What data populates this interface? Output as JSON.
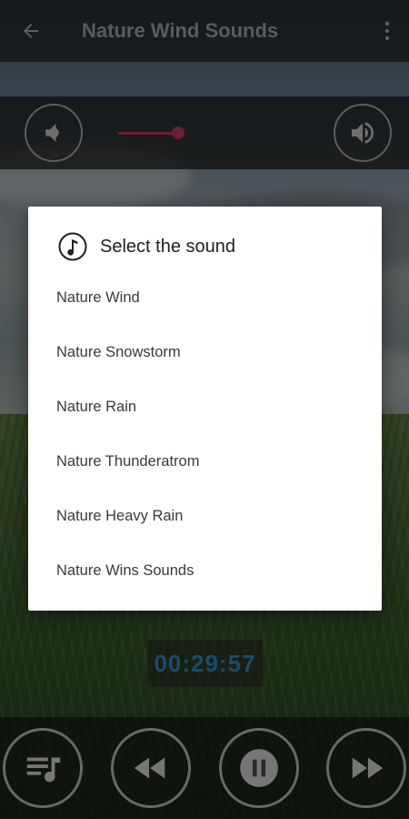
{
  "app_bar": {
    "title": "Nature Wind Sounds",
    "back_icon": "arrow-left-icon",
    "menu_icon": "more-vertical-icon"
  },
  "volume": {
    "level": 0.2,
    "down_icon": "volume-down-icon",
    "up_icon": "volume-up-icon"
  },
  "dialog": {
    "title": "Select the sound",
    "title_icon": "music-note-icon",
    "items": [
      {
        "label": "Nature Wind"
      },
      {
        "label": "Nature Snowstorm"
      },
      {
        "label": "Nature Rain"
      },
      {
        "label": "Nature Thunderatrom"
      },
      {
        "label": "Nature Heavy Rain"
      },
      {
        "label": "Nature Wins Sounds"
      }
    ]
  },
  "timer": {
    "value": "00:29:57"
  },
  "controls": {
    "playlist_icon": "playlist-music-icon",
    "rewind_icon": "rewind-icon",
    "pause_icon": "pause-icon",
    "forward_icon": "fast-forward-icon"
  },
  "colors": {
    "accent": "#6c1f35",
    "timer_text": "#1c4b6c"
  }
}
